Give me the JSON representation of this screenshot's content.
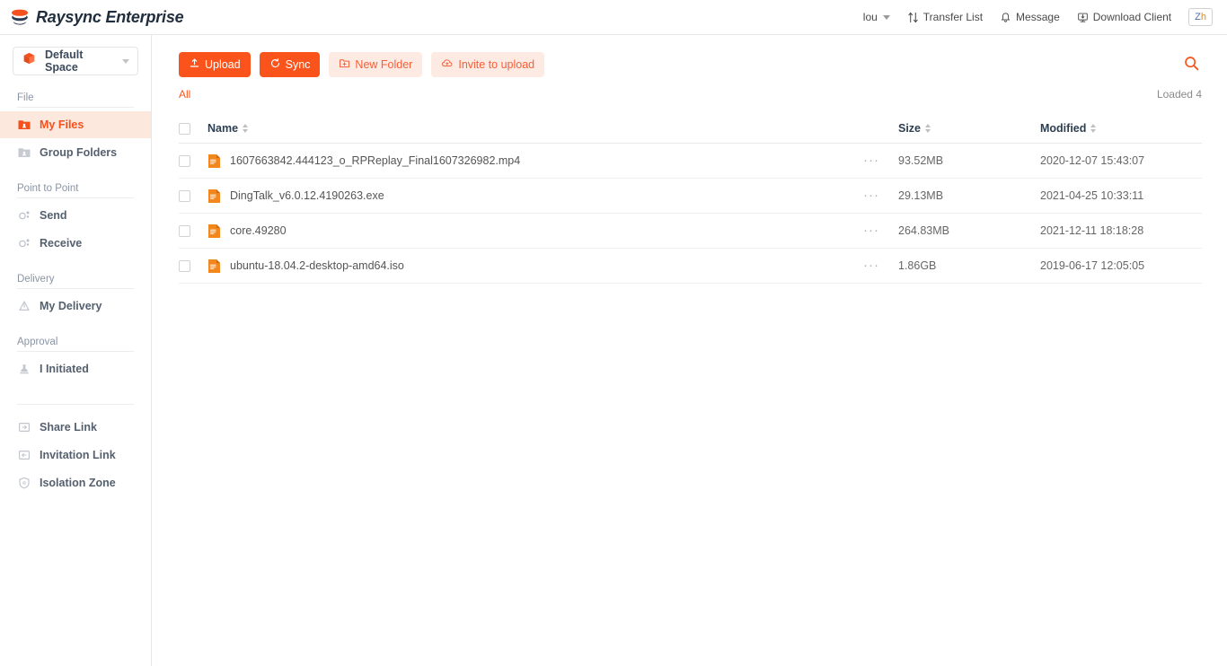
{
  "app": {
    "brand_name": "Raysync Enterprise",
    "logo_icon": "raysync-layers-logo",
    "accent_color": "#fa541c",
    "accent_light": "#fdeae2",
    "active_nav_bg": "#fde8de"
  },
  "header": {
    "user": {
      "label": "lou",
      "icon": "chevron-down-icon"
    },
    "items": [
      {
        "label": "Transfer List",
        "icon": "transfer-list-icon"
      },
      {
        "label": "Message",
        "icon": "bell-icon"
      },
      {
        "label": "Download Client",
        "icon": "download-client-icon"
      }
    ],
    "language": {
      "label": "Zh",
      "first": "Z",
      "second": "h"
    }
  },
  "sidebar": {
    "space": {
      "label": "Default Space",
      "icon": "cube-icon",
      "caret": "chevron-down-icon"
    },
    "groups": [
      {
        "label": "File",
        "items": [
          {
            "label": "My Files",
            "icon": "folder-user-icon",
            "active": true
          },
          {
            "label": "Group Folders",
            "icon": "folder-group-icon",
            "active": false
          }
        ]
      },
      {
        "label": "Point to Point",
        "items": [
          {
            "label": "Send",
            "icon": "send-node-icon",
            "active": false
          },
          {
            "label": "Receive",
            "icon": "receive-node-icon",
            "active": false
          }
        ]
      },
      {
        "label": "Delivery",
        "items": [
          {
            "label": "My Delivery",
            "icon": "delivery-icon",
            "active": false
          }
        ]
      },
      {
        "label": "Approval",
        "items": [
          {
            "label": "I Initiated",
            "icon": "approval-stamp-icon",
            "active": false
          }
        ]
      }
    ],
    "extra_items": [
      {
        "label": "Share Link",
        "icon": "share-link-icon"
      },
      {
        "label": "Invitation Link",
        "icon": "invitation-link-icon"
      },
      {
        "label": "Isolation Zone",
        "icon": "shield-icon"
      }
    ]
  },
  "toolbar": {
    "upload_label": "Upload",
    "upload_icon": "upload-icon",
    "sync_label": "Sync",
    "sync_icon": "sync-icon",
    "new_folder_label": "New Folder",
    "new_folder_icon": "folder-plus-icon",
    "invite_label": "Invite to upload",
    "invite_icon": "cloud-upload-icon",
    "search_icon": "search-icon"
  },
  "breadcrumb": {
    "root_label": "All"
  },
  "status": {
    "loaded_label": "Loaded 4"
  },
  "table": {
    "columns": {
      "name": "Name",
      "size": "Size",
      "modified": "Modified"
    },
    "rows": [
      {
        "name": "1607663842.444123_o_RPReplay_Final1607326982.mp4",
        "size": "93.52MB",
        "modified": "2020-12-07 15:43:07",
        "icon": "file-doc-icon",
        "menu": "···"
      },
      {
        "name": "DingTalk_v6.0.12.4190263.exe",
        "size": "29.13MB",
        "modified": "2021-04-25 10:33:11",
        "icon": "file-doc-icon",
        "menu": "···"
      },
      {
        "name": "core.49280",
        "size": "264.83MB",
        "modified": "2021-12-11 18:18:28",
        "icon": "file-doc-icon",
        "menu": "···"
      },
      {
        "name": "ubuntu-18.04.2-desktop-amd64.iso",
        "size": "1.86GB",
        "modified": "2019-06-17 12:05:05",
        "icon": "file-doc-icon",
        "menu": "···"
      }
    ]
  }
}
